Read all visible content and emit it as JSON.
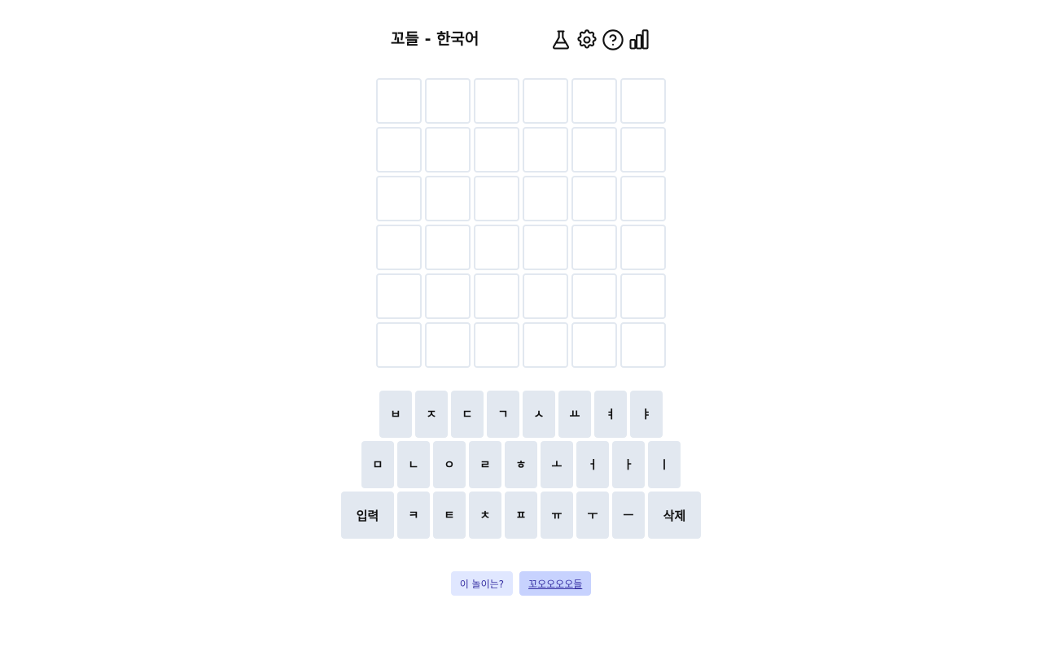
{
  "header": {
    "title": "꼬들 - 한국어",
    "icons": [
      "flask-icon",
      "gear-icon",
      "help-circle-icon",
      "bar-chart-icon"
    ]
  },
  "grid": {
    "rows": 6,
    "cols": 6,
    "cells": [
      [
        "",
        "",
        "",
        "",
        "",
        ""
      ],
      [
        "",
        "",
        "",
        "",
        "",
        ""
      ],
      [
        "",
        "",
        "",
        "",
        "",
        ""
      ],
      [
        "",
        "",
        "",
        "",
        "",
        ""
      ],
      [
        "",
        "",
        "",
        "",
        "",
        ""
      ],
      [
        "",
        "",
        "",
        "",
        "",
        ""
      ]
    ]
  },
  "keyboard": {
    "row1": [
      "ㅂ",
      "ㅈ",
      "ㄷ",
      "ㄱ",
      "ㅅ",
      "ㅛ",
      "ㅕ",
      "ㅑ"
    ],
    "row2": [
      "ㅁ",
      "ㄴ",
      "ㅇ",
      "ㄹ",
      "ㅎ",
      "ㅗ",
      "ㅓ",
      "ㅏ",
      "ㅣ"
    ],
    "row3": [
      "ㅋ",
      "ㅌ",
      "ㅊ",
      "ㅍ",
      "ㅠ",
      "ㅜ",
      "ㅡ"
    ],
    "enter_label": "입력",
    "delete_label": "삭제"
  },
  "footer": {
    "about_label": "이 놀이는?",
    "long_mode_label": "꼬오오오오들"
  },
  "colors": {
    "tile_border": "#e2e8f0",
    "key_bg": "#e2e8f0",
    "about_bg": "#e0e7ff",
    "long_bg": "#c7d2fe",
    "link_text": "#3730a3"
  }
}
